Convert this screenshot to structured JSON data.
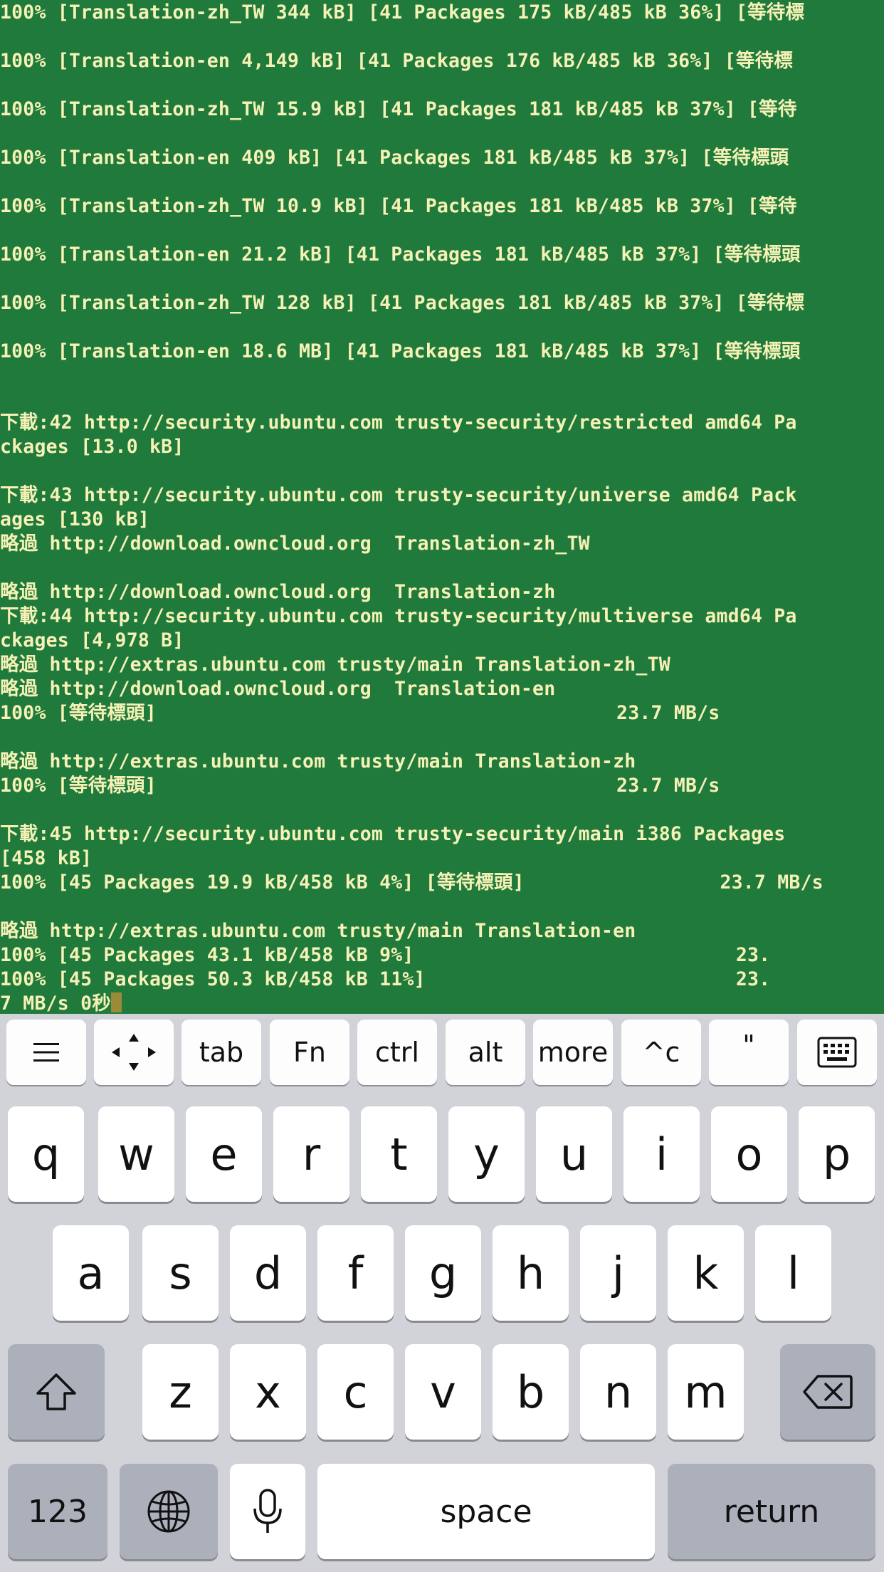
{
  "terminal": {
    "lines": [
      "100% [Translation-zh_TW 344 kB] [41 Packages 175 kB/485 kB 36%] [等待標",
      "100% [Translation-en 4,149 kB] [41 Packages 176 kB/485 kB 36%] [等待標",
      "100% [Translation-zh_TW 15.9 kB] [41 Packages 181 kB/485 kB 37%] [等待",
      "100% [Translation-en 409 kB] [41 Packages 181 kB/485 kB 37%] [等待標頭",
      "100% [Translation-zh_TW 10.9 kB] [41 Packages 181 kB/485 kB 37%] [等待",
      "100% [Translation-en 21.2 kB] [41 Packages 181 kB/485 kB 37%] [等待標頭",
      "100% [Translation-zh_TW 128 kB] [41 Packages 181 kB/485 kB 37%] [等待標",
      "100% [Translation-en 18.6 MB] [41 Packages 181 kB/485 kB 37%] [等待標頭",
      "下載:42 http://security.ubuntu.com trusty-security/restricted amd64 Pa",
      "ckages [13.0 kB]",
      "下載:43 http://security.ubuntu.com trusty-security/universe amd64 Pack",
      "ages [130 kB]",
      "略過 http://download.owncloud.org  Translation-zh_TW",
      "略過 http://download.owncloud.org  Translation-zh",
      "下載:44 http://security.ubuntu.com trusty-security/multiverse amd64 Pa",
      "ckages [4,978 B]",
      "略過 http://extras.ubuntu.com trusty/main Translation-zh_TW",
      "略過 http://download.owncloud.org  Translation-en",
      "100% [等待標頭]                                        23.7 MB/s",
      "略過 http://extras.ubuntu.com trusty/main Translation-zh",
      "100% [等待標頭]                                        23.7 MB/s",
      "下載:45 http://security.ubuntu.com trusty-security/main i386 Packages",
      "[458 kB]",
      "100% [45 Packages 19.9 kB/458 kB 4%] [等待標頭]                 23.7 MB/s",
      "略過 http://extras.ubuntu.com trusty/main Translation-en",
      "100% [45 Packages 43.1 kB/458 kB 9%]                            23.",
      "100% [45 Packages 50.3 kB/458 kB 11%]                           23.",
      "7 MB/s 0秒"
    ]
  },
  "accessory_bar": {
    "menu_icon": "hamburger-menu-icon",
    "arrows_icon": "arrow-keys-icon",
    "tab": "tab",
    "fn": "Fn",
    "ctrl": "ctrl",
    "alt": "alt",
    "more": "more",
    "ctrl_c": "^c",
    "quote": "\"",
    "keyboard_icon": "keyboard-icon"
  },
  "keyboard": {
    "row1": [
      "q",
      "w",
      "e",
      "r",
      "t",
      "y",
      "u",
      "i",
      "o",
      "p"
    ],
    "row2": [
      "a",
      "s",
      "d",
      "f",
      "g",
      "h",
      "j",
      "k",
      "l"
    ],
    "row3": [
      "z",
      "x",
      "c",
      "v",
      "b",
      "n",
      "m"
    ],
    "shift_icon": "shift-icon",
    "delete_icon": "backspace-icon",
    "numbers": "123",
    "globe_icon": "globe-icon",
    "mic_icon": "microphone-icon",
    "space": "space",
    "return": "return"
  },
  "colors": {
    "terminal_bg": "#1f7a3b",
    "terminal_text": "#f6f1b6",
    "keyboard_bg": "#d1d3d9"
  }
}
